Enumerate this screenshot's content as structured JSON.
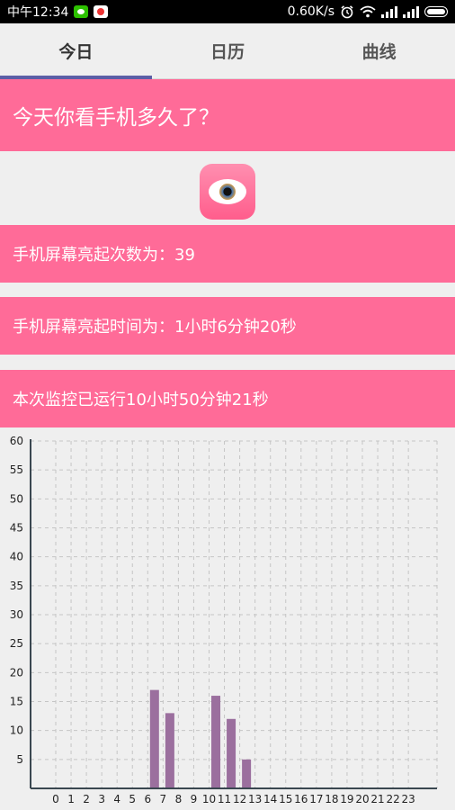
{
  "status_bar": {
    "time": "中午12:34",
    "speed": "0.60K/s",
    "icons": [
      "wechat-icon",
      "app-notification-icon",
      "alarm-icon",
      "wifi-icon",
      "signal-icon",
      "signal-icon",
      "battery-icon"
    ]
  },
  "tabs": [
    {
      "label": "今日",
      "active": true
    },
    {
      "label": "日历",
      "active": false
    },
    {
      "label": "曲线",
      "active": false
    }
  ],
  "question": "今天你看手机多久了？",
  "stats": {
    "unlock_count": "手机屏幕亮起次数为：39",
    "screen_time": "手机屏幕亮起时间为：1小时6分钟20秒",
    "running_time": "本次监控已运行10小时50分钟21秒"
  },
  "colors": {
    "banner": "#ff6b98",
    "bar": "#9b6f9e",
    "tab_indicator": "#5b5ea6"
  },
  "chart_data": {
    "type": "bar",
    "categories": [
      "0",
      "1",
      "2",
      "3",
      "4",
      "5",
      "6",
      "7",
      "8",
      "9",
      "10",
      "11",
      "12",
      "13",
      "14",
      "15",
      "16",
      "17",
      "18",
      "19",
      "20",
      "21",
      "22",
      "23"
    ],
    "values": [
      0,
      0,
      0,
      0,
      0,
      0,
      17,
      13,
      0,
      0,
      16,
      12,
      5,
      0,
      0,
      0,
      0,
      0,
      0,
      0,
      0,
      0,
      0,
      0
    ],
    "yticks": [
      "5",
      "10",
      "15",
      "20",
      "25",
      "30",
      "35",
      "40",
      "45",
      "50",
      "55",
      "60"
    ],
    "ylim": [
      0,
      60
    ],
    "grid": true
  }
}
